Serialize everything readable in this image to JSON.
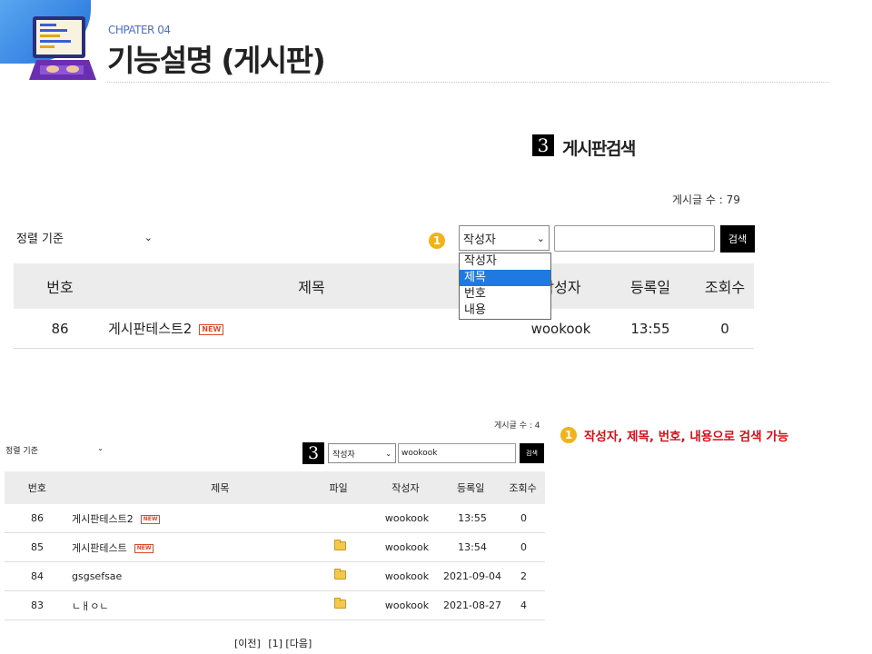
{
  "header": {
    "chapter": "CHPATER 04",
    "title": "기능설명 (게시판)"
  },
  "section": {
    "number": "3",
    "label": "게시판검색"
  },
  "top_board": {
    "post_count": "게시글 수 : 79",
    "sort_label": "정렬 기준",
    "badge": "1",
    "search_select_value": "작성자",
    "search_button": "검색",
    "dropdown_options": [
      "작성자",
      "제목",
      "번호",
      "내용"
    ],
    "dropdown_selected_index": 1,
    "columns": [
      "번호",
      "제목",
      "작성자",
      "등록일",
      "조회수"
    ],
    "rows": [
      {
        "no": "86",
        "title": "게시판테스트2",
        "new": "NEW",
        "author": "wookook",
        "date": "13:55",
        "views": "0"
      }
    ]
  },
  "annotation": {
    "badge": "1",
    "text": "작성자, 제목, 번호, 내용으로 검색 가능"
  },
  "bottom_board": {
    "post_count": "게시글 수 : 4",
    "sort_label": "정렬 기준",
    "number_box": "3",
    "search_select_value": "작성자",
    "search_input_value": "wookook",
    "search_button": "검색",
    "columns": [
      "번호",
      "제목",
      "파일",
      "작성자",
      "등록일",
      "조회수"
    ],
    "rows": [
      {
        "no": "86",
        "title": "게시판테스트2",
        "new": "NEW",
        "file": false,
        "author": "wookook",
        "date": "13:55",
        "views": "0"
      },
      {
        "no": "85",
        "title": "게시판테스트",
        "new": "NEW",
        "file": true,
        "author": "wookook",
        "date": "13:54",
        "views": "0"
      },
      {
        "no": "84",
        "title": "gsgsefsae",
        "new": "",
        "file": true,
        "author": "wookook",
        "date": "2021-09-04",
        "views": "2"
      },
      {
        "no": "83",
        "title": "ㄴㅐㅇㄴ",
        "new": "",
        "file": true,
        "author": "wookook",
        "date": "2021-08-27",
        "views": "4"
      }
    ],
    "pagination": {
      "prev": "[이전]",
      "page": "[1]",
      "next": "[다음]"
    }
  },
  "colors": {
    "accent_red": "#d6101a",
    "badge_yellow": "#f2b318",
    "header_blue": "#1e6fd9",
    "table_head": "#ececec"
  }
}
